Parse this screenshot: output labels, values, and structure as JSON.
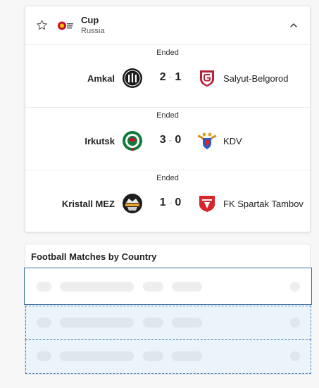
{
  "competition": {
    "name": "Cup",
    "country": "Russia"
  },
  "matches": [
    {
      "status": "Ended",
      "home": "Amkal",
      "home_score": "2",
      "separator": "-",
      "away_score": "1",
      "away": "Salyut-Belgorod"
    },
    {
      "status": "Ended",
      "home": "Irkutsk",
      "home_score": "3",
      "separator": "-",
      "away_score": "0",
      "away": "KDV"
    },
    {
      "status": "Ended",
      "home": "Kristall MEZ",
      "home_score": "1",
      "separator": "-",
      "away_score": "0",
      "away": "FK Spartak Tambov"
    }
  ],
  "countries_section": {
    "title": "Football Matches by Country"
  },
  "colors": {
    "accent_blue": "#3a6ea5",
    "skeleton_highlight": "#ebf4fb",
    "salyut_red": "#b8203a",
    "kdv_blue": "#2a5cbf",
    "spartak_red": "#d8262c"
  },
  "icons": {
    "favorite": "star-outline-icon",
    "collapse": "chevron-up-icon"
  }
}
